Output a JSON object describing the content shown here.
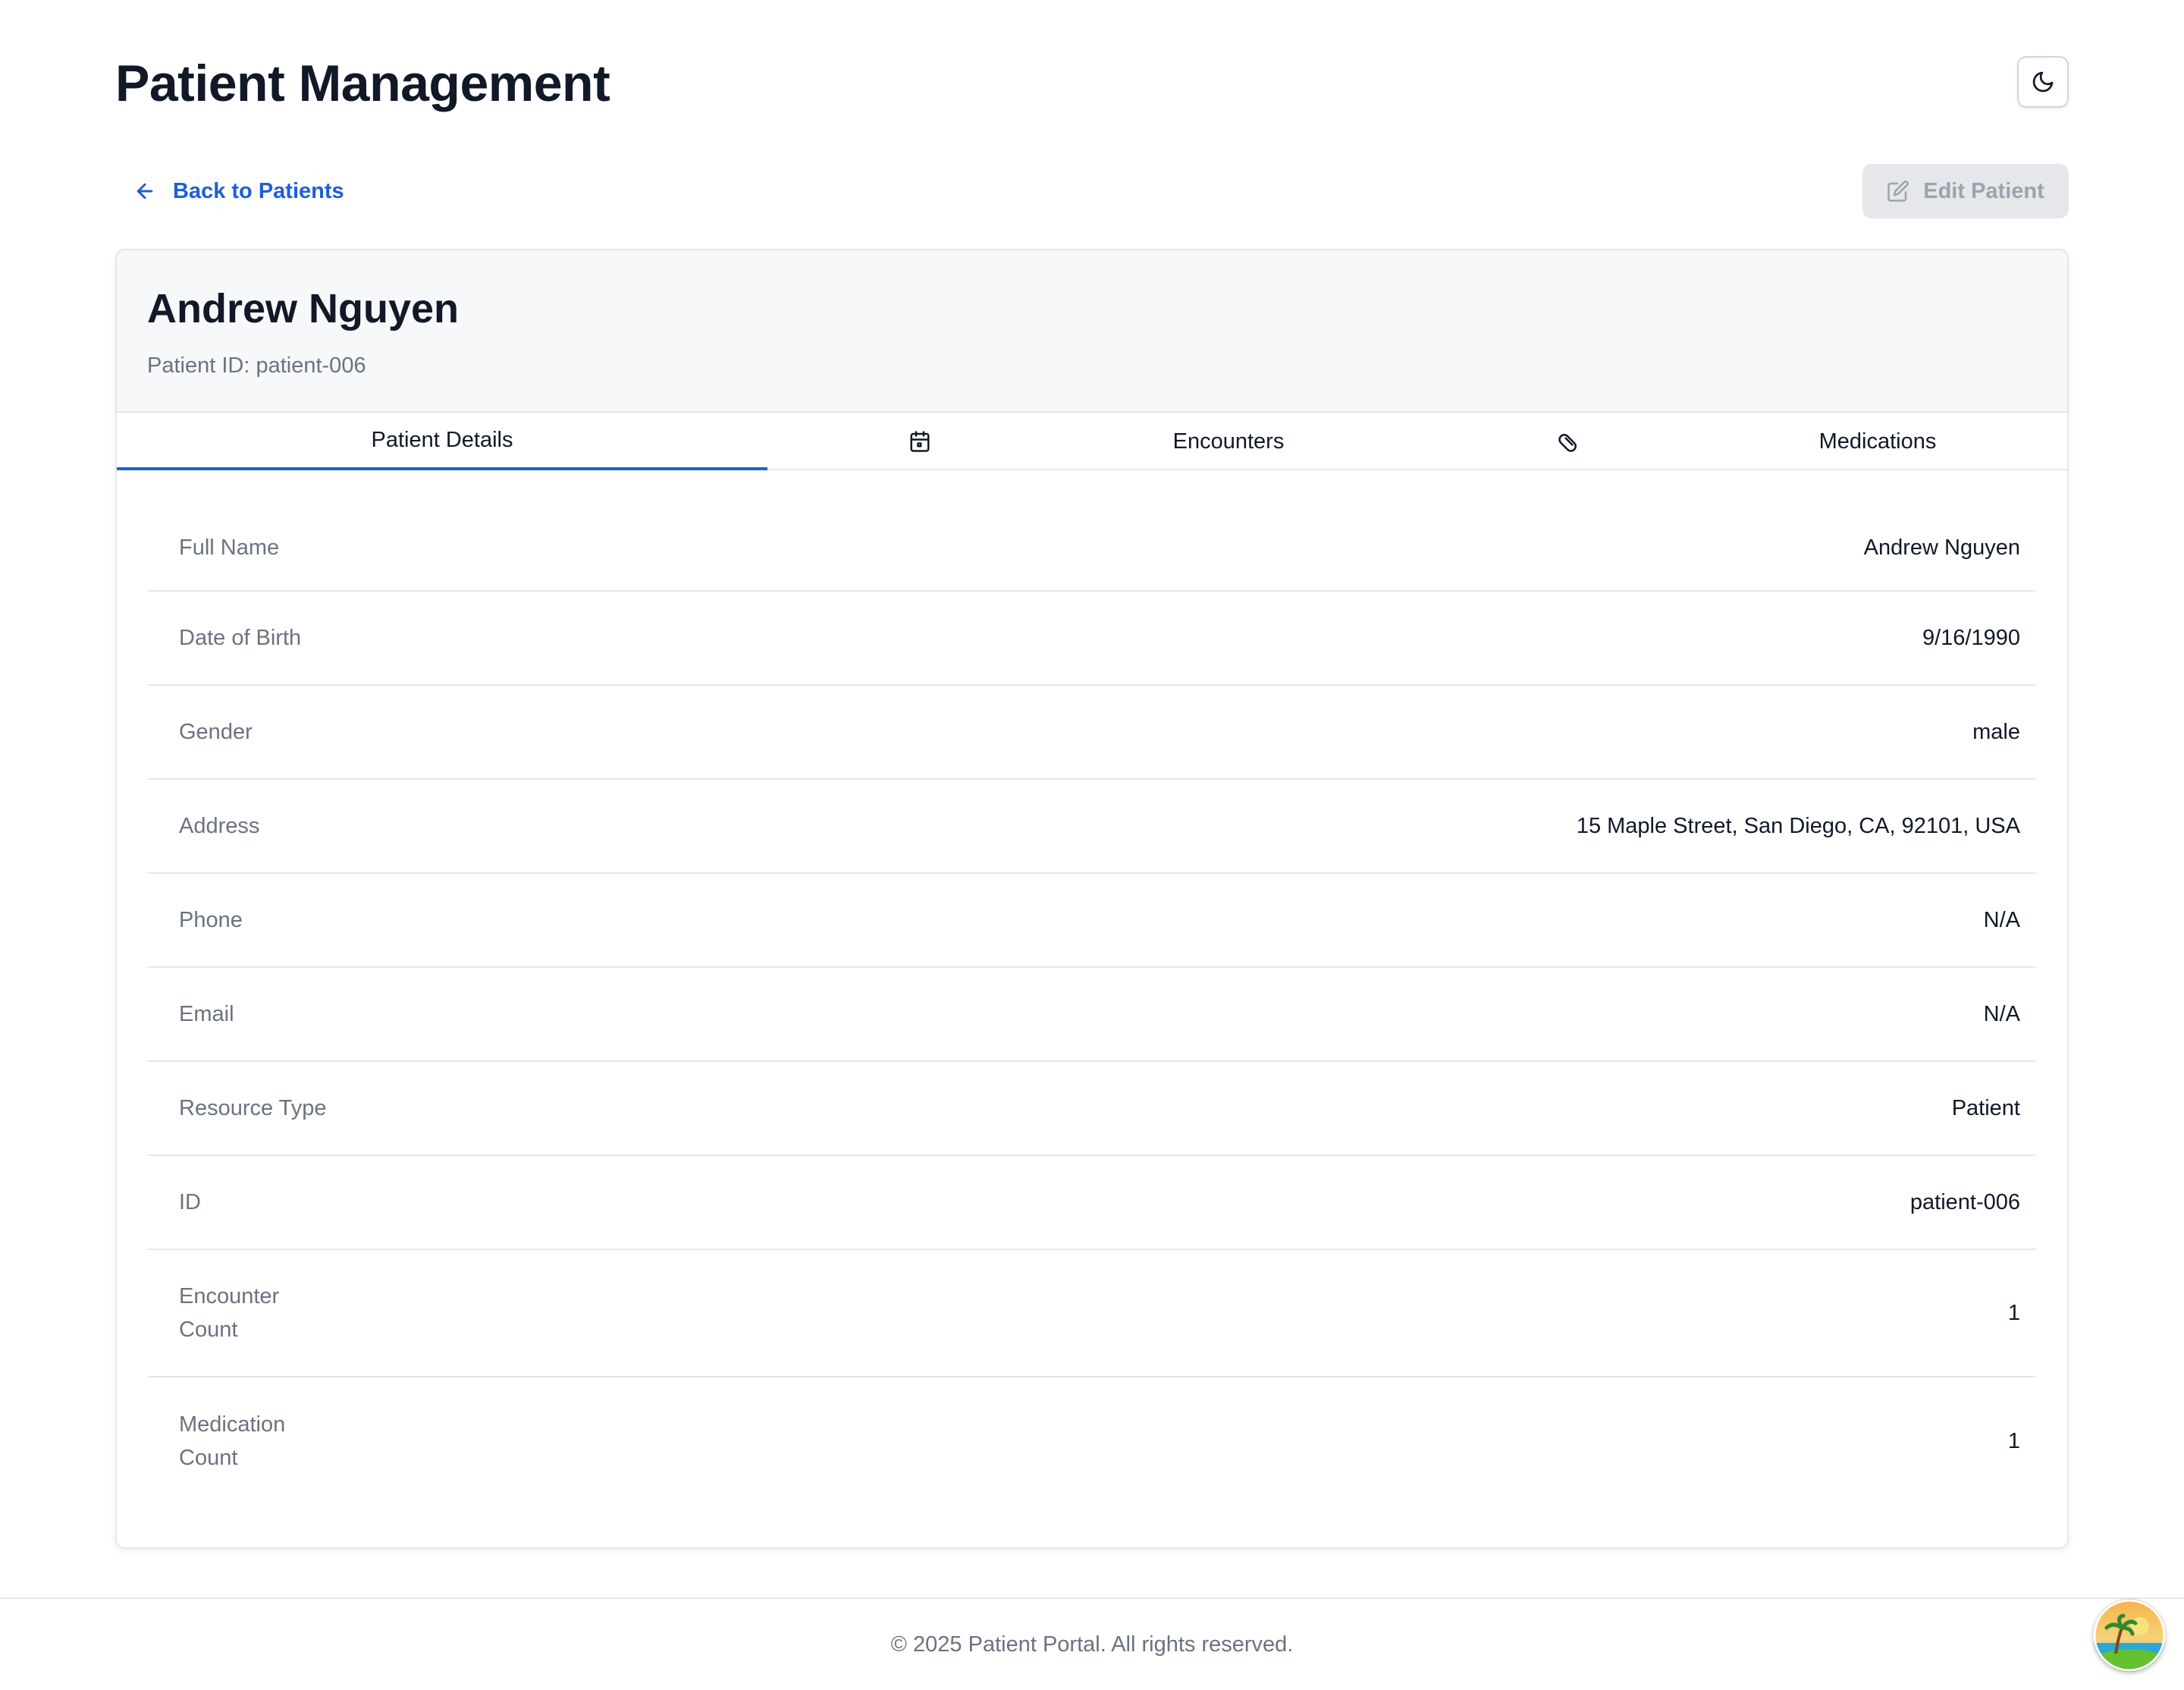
{
  "header": {
    "title": "Patient Management",
    "theme_toggle_icon": "moon-icon"
  },
  "nav": {
    "back_label": "Back to Patients",
    "edit_label": "Edit Patient"
  },
  "patient": {
    "name": "Andrew Nguyen",
    "id_label": "Patient ID: patient-006"
  },
  "tabs": [
    {
      "label": "Patient Details",
      "active": true
    },
    {
      "label": "Encounters",
      "icon": "calendar-icon",
      "active": false
    },
    {
      "label": "Medications",
      "icon": "pill-icon",
      "active": false
    }
  ],
  "details": [
    {
      "label": "Full Name",
      "value": "Andrew Nguyen"
    },
    {
      "label": "Date of Birth",
      "value": "9/16/1990"
    },
    {
      "label": "Gender",
      "value": "male"
    },
    {
      "label": "Address",
      "value": "15 Maple Street, San Diego, CA, 92101, USA"
    },
    {
      "label": "Phone",
      "value": "N/A"
    },
    {
      "label": "Email",
      "value": "N/A"
    },
    {
      "label": "Resource Type",
      "value": "Patient"
    },
    {
      "label": "ID",
      "value": "patient-006"
    },
    {
      "label": "Encounter Count",
      "value": "1"
    },
    {
      "label": "Medication Count",
      "value": "1"
    }
  ],
  "footer": {
    "text": "© 2025 Patient Portal. All rights reserved."
  },
  "colors": {
    "accent": "#1d5fd6",
    "muted_text": "#6b7280",
    "border": "#e5e7eb",
    "header_bg": "#f7f8fa"
  }
}
